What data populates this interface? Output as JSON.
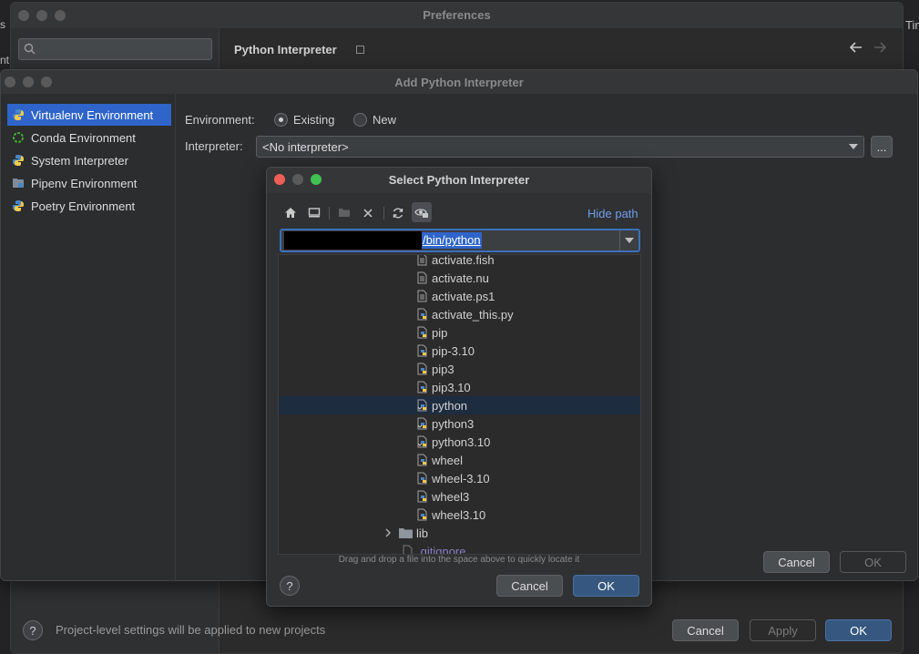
{
  "prefs": {
    "title": "Preferences",
    "search_placeholder": "",
    "section_title": "Python Interpreter",
    "footer_note": "Project-level settings will be applied to new projects",
    "cancel": "Cancel",
    "apply": "Apply",
    "ok": "OK",
    "help": "?",
    "edge_left_1": "s",
    "edge_left_2": "nt",
    "edge_right": "Tin"
  },
  "add_dialog": {
    "title": "Add Python Interpreter",
    "sidebar": [
      {
        "label": "Virtualenv Environment",
        "icon": "python-icon",
        "selected": true
      },
      {
        "label": "Conda Environment",
        "icon": "conda-icon",
        "selected": false
      },
      {
        "label": "System Interpreter",
        "icon": "python-icon",
        "selected": false
      },
      {
        "label": "Pipenv Environment",
        "icon": "pipenv-icon",
        "selected": false
      },
      {
        "label": "Poetry Environment",
        "icon": "python-icon",
        "selected": false
      }
    ],
    "environment_label": "Environment:",
    "existing_label": "Existing",
    "new_label": "New",
    "environment_selected": "Existing",
    "interpreter_label": "Interpreter:",
    "interpreter_value": "<No interpreter>",
    "browse_label": "...",
    "cancel": "Cancel",
    "ok": "OK"
  },
  "select_dialog": {
    "title": "Select Python Interpreter",
    "hide_path": "Hide path",
    "path_value": "/bin/python",
    "files": [
      {
        "name": "activate.fish",
        "icon": "text-file-icon"
      },
      {
        "name": "activate.nu",
        "icon": "text-file-icon"
      },
      {
        "name": "activate.ps1",
        "icon": "text-file-icon"
      },
      {
        "name": "activate_this.py",
        "icon": "python-file-icon"
      },
      {
        "name": "pip",
        "icon": "python-file-icon"
      },
      {
        "name": "pip-3.10",
        "icon": "python-file-icon"
      },
      {
        "name": "pip3",
        "icon": "python-file-icon"
      },
      {
        "name": "pip3.10",
        "icon": "python-file-icon"
      },
      {
        "name": "python",
        "icon": "python-link-icon",
        "selected": true
      },
      {
        "name": "python3",
        "icon": "python-link-icon"
      },
      {
        "name": "python3.10",
        "icon": "python-link-icon"
      },
      {
        "name": "wheel",
        "icon": "python-file-icon"
      },
      {
        "name": "wheel-3.10",
        "icon": "python-file-icon"
      },
      {
        "name": "wheel3",
        "icon": "python-file-icon"
      },
      {
        "name": "wheel3.10",
        "icon": "python-file-icon"
      }
    ],
    "folder": "lib",
    "partial_item": ".gitignore",
    "drag_hint": "Drag and drop a file into the space above to quickly locate it",
    "help": "?",
    "cancel": "Cancel",
    "ok": "OK"
  }
}
